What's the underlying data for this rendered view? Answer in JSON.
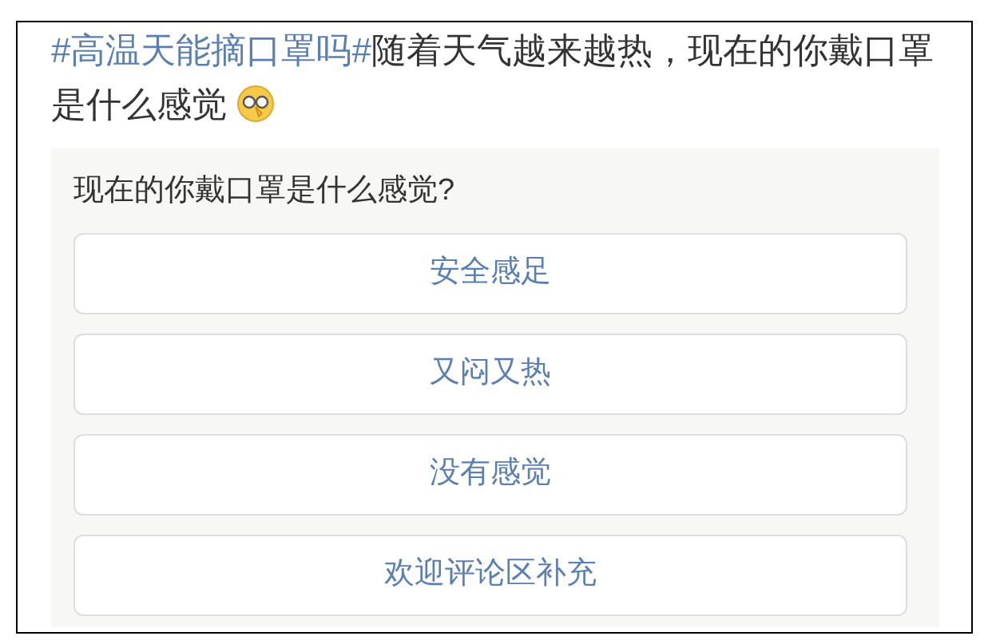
{
  "post": {
    "hashtag": "#高温天能摘口罩吗#",
    "text": "随着天气越来越热，现在的你戴口罩是什么感觉"
  },
  "poll": {
    "question": "现在的你戴口罩是什么感觉?",
    "options": [
      {
        "label": "安全感足"
      },
      {
        "label": "又闷又热"
      },
      {
        "label": "没有感觉"
      },
      {
        "label": "欢迎评论区补充"
      }
    ]
  }
}
